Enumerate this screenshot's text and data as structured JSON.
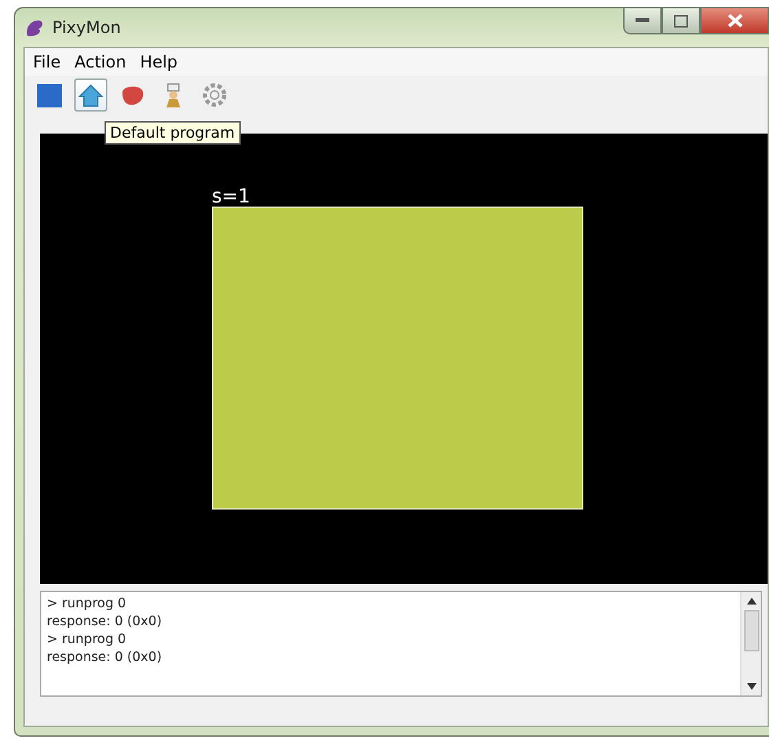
{
  "window": {
    "title": "PixyMon"
  },
  "menu": [
    "File",
    "Action",
    "Help"
  ],
  "toolbar": [
    {
      "kind": "square",
      "highlighted": false
    },
    {
      "kind": "home",
      "highlighted": true
    },
    {
      "kind": "steak",
      "highlighted": false
    },
    {
      "kind": "chef",
      "highlighted": false
    },
    {
      "kind": "gear",
      "highlighted": false
    }
  ],
  "tooltip": "Default program",
  "video": {
    "block_label": "s=1"
  },
  "console": [
    "> runprog 0",
    "response: 0 (0x0)",
    "> runprog 0",
    "response: 0 (0x0)"
  ]
}
